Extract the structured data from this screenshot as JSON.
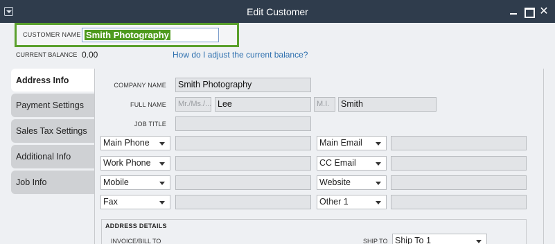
{
  "window": {
    "title": "Edit Customer",
    "close_glyph": "✕"
  },
  "header": {
    "customer_name_label": "CUSTOMER NAME",
    "customer_name_value": "Smith Photography",
    "current_balance_label": "CURRENT BALANCE",
    "current_balance_value": "0.00",
    "help_link": "How do I adjust the current balance?"
  },
  "tabs": [
    {
      "label": "Address Info",
      "active": true
    },
    {
      "label": "Payment Settings"
    },
    {
      "label": "Sales Tax Settings"
    },
    {
      "label": "Additional Info"
    },
    {
      "label": "Job Info"
    }
  ],
  "form": {
    "company_name_label": "COMPANY NAME",
    "company_name_value": "Smith Photography",
    "full_name_label": "FULL NAME",
    "salutation_placeholder": "Mr./Ms./...",
    "first_name_value": "Lee",
    "mi_placeholder": "M.I.",
    "last_name_value": "Smith",
    "job_title_label": "JOB TITLE",
    "contacts_left": [
      "Main Phone",
      "Work Phone",
      "Mobile",
      "Fax"
    ],
    "contacts_right": [
      "Main Email",
      "CC Email",
      "Website",
      "Other 1"
    ]
  },
  "address": {
    "title": "ADDRESS DETAILS",
    "invoice_label": "INVOICE/BILL TO",
    "ship_to_label": "SHIP TO",
    "ship_to_value": "Ship To 1"
  },
  "colors": {
    "title_bar": "#2f3c4c",
    "highlight_green": "#5aa02c",
    "link_blue": "#2d6fae"
  }
}
